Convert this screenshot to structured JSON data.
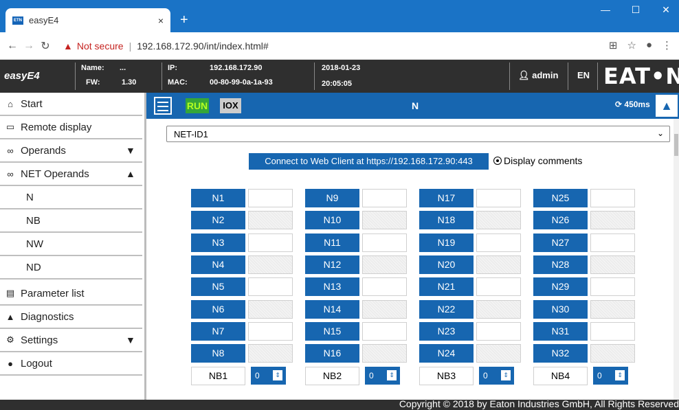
{
  "browser": {
    "favicon": "ETN",
    "tab_title": "easyE4",
    "tab_close": "×",
    "new_tab": "+",
    "not_secure": "Not secure",
    "url": "192.168.172.90/int/index.html#"
  },
  "header": {
    "brand": "easyE4",
    "name_label": "Name:",
    "name_value": "...",
    "fw_label": "FW:",
    "fw_value": "1.30",
    "ip_label": "IP:",
    "ip_value": "192.168.172.90",
    "mac_label": "MAC:",
    "mac_value": "00-80-99-0a-1a-93",
    "date": "2018-01-23",
    "time": "20:05:05",
    "user": "admin",
    "lang": "EN",
    "logo": "EAT•N"
  },
  "sidebar": {
    "items": [
      {
        "label": "Start",
        "icon": "home-icon"
      },
      {
        "label": "Remote display",
        "icon": "monitor-icon"
      },
      {
        "label": "Operands",
        "icon": "link-icon"
      },
      {
        "label": "NET Operands",
        "icon": "link-icon"
      },
      {
        "label": "N"
      },
      {
        "label": "NB"
      },
      {
        "label": "NW"
      },
      {
        "label": "ND"
      },
      {
        "label": "Parameter list",
        "icon": "list-icon"
      },
      {
        "label": "Diagnostics",
        "icon": "warning-icon"
      },
      {
        "label": "Settings",
        "icon": "gear-icon"
      },
      {
        "label": "Logout",
        "icon": "user-icon"
      }
    ]
  },
  "toolbar": {
    "run": "RUN",
    "iox": "IOX",
    "title": "N",
    "cycle": "450ms"
  },
  "main": {
    "net_select": "NET-ID1",
    "connect_label": "Connect to Web Client at https://192.168.172.90:443",
    "display_comments": "Display comments",
    "n_columns": [
      [
        "N1",
        "N2",
        "N3",
        "N4",
        "N5",
        "N6",
        "N7",
        "N8"
      ],
      [
        "N9",
        "N10",
        "N11",
        "N12",
        "N13",
        "N14",
        "N15",
        "N16"
      ],
      [
        "N17",
        "N18",
        "N19",
        "N20",
        "N21",
        "N22",
        "N23",
        "N24"
      ],
      [
        "N25",
        "N26",
        "N27",
        "N28",
        "N29",
        "N30",
        "N31",
        "N32"
      ]
    ],
    "nb_row": [
      {
        "label": "NB1",
        "value": "0"
      },
      {
        "label": "NB2",
        "value": "0"
      },
      {
        "label": "NB3",
        "value": "0"
      },
      {
        "label": "NB4",
        "value": "0"
      }
    ]
  },
  "footer": {
    "copyright": "Copyright © 2018 by Eaton Industries GmbH, All Rights Reserved"
  },
  "colors": {
    "accent": "#1766b0",
    "header_bg": "#2f2f2f",
    "run_bg": "#35a638",
    "chrome": "#1a73c6"
  }
}
